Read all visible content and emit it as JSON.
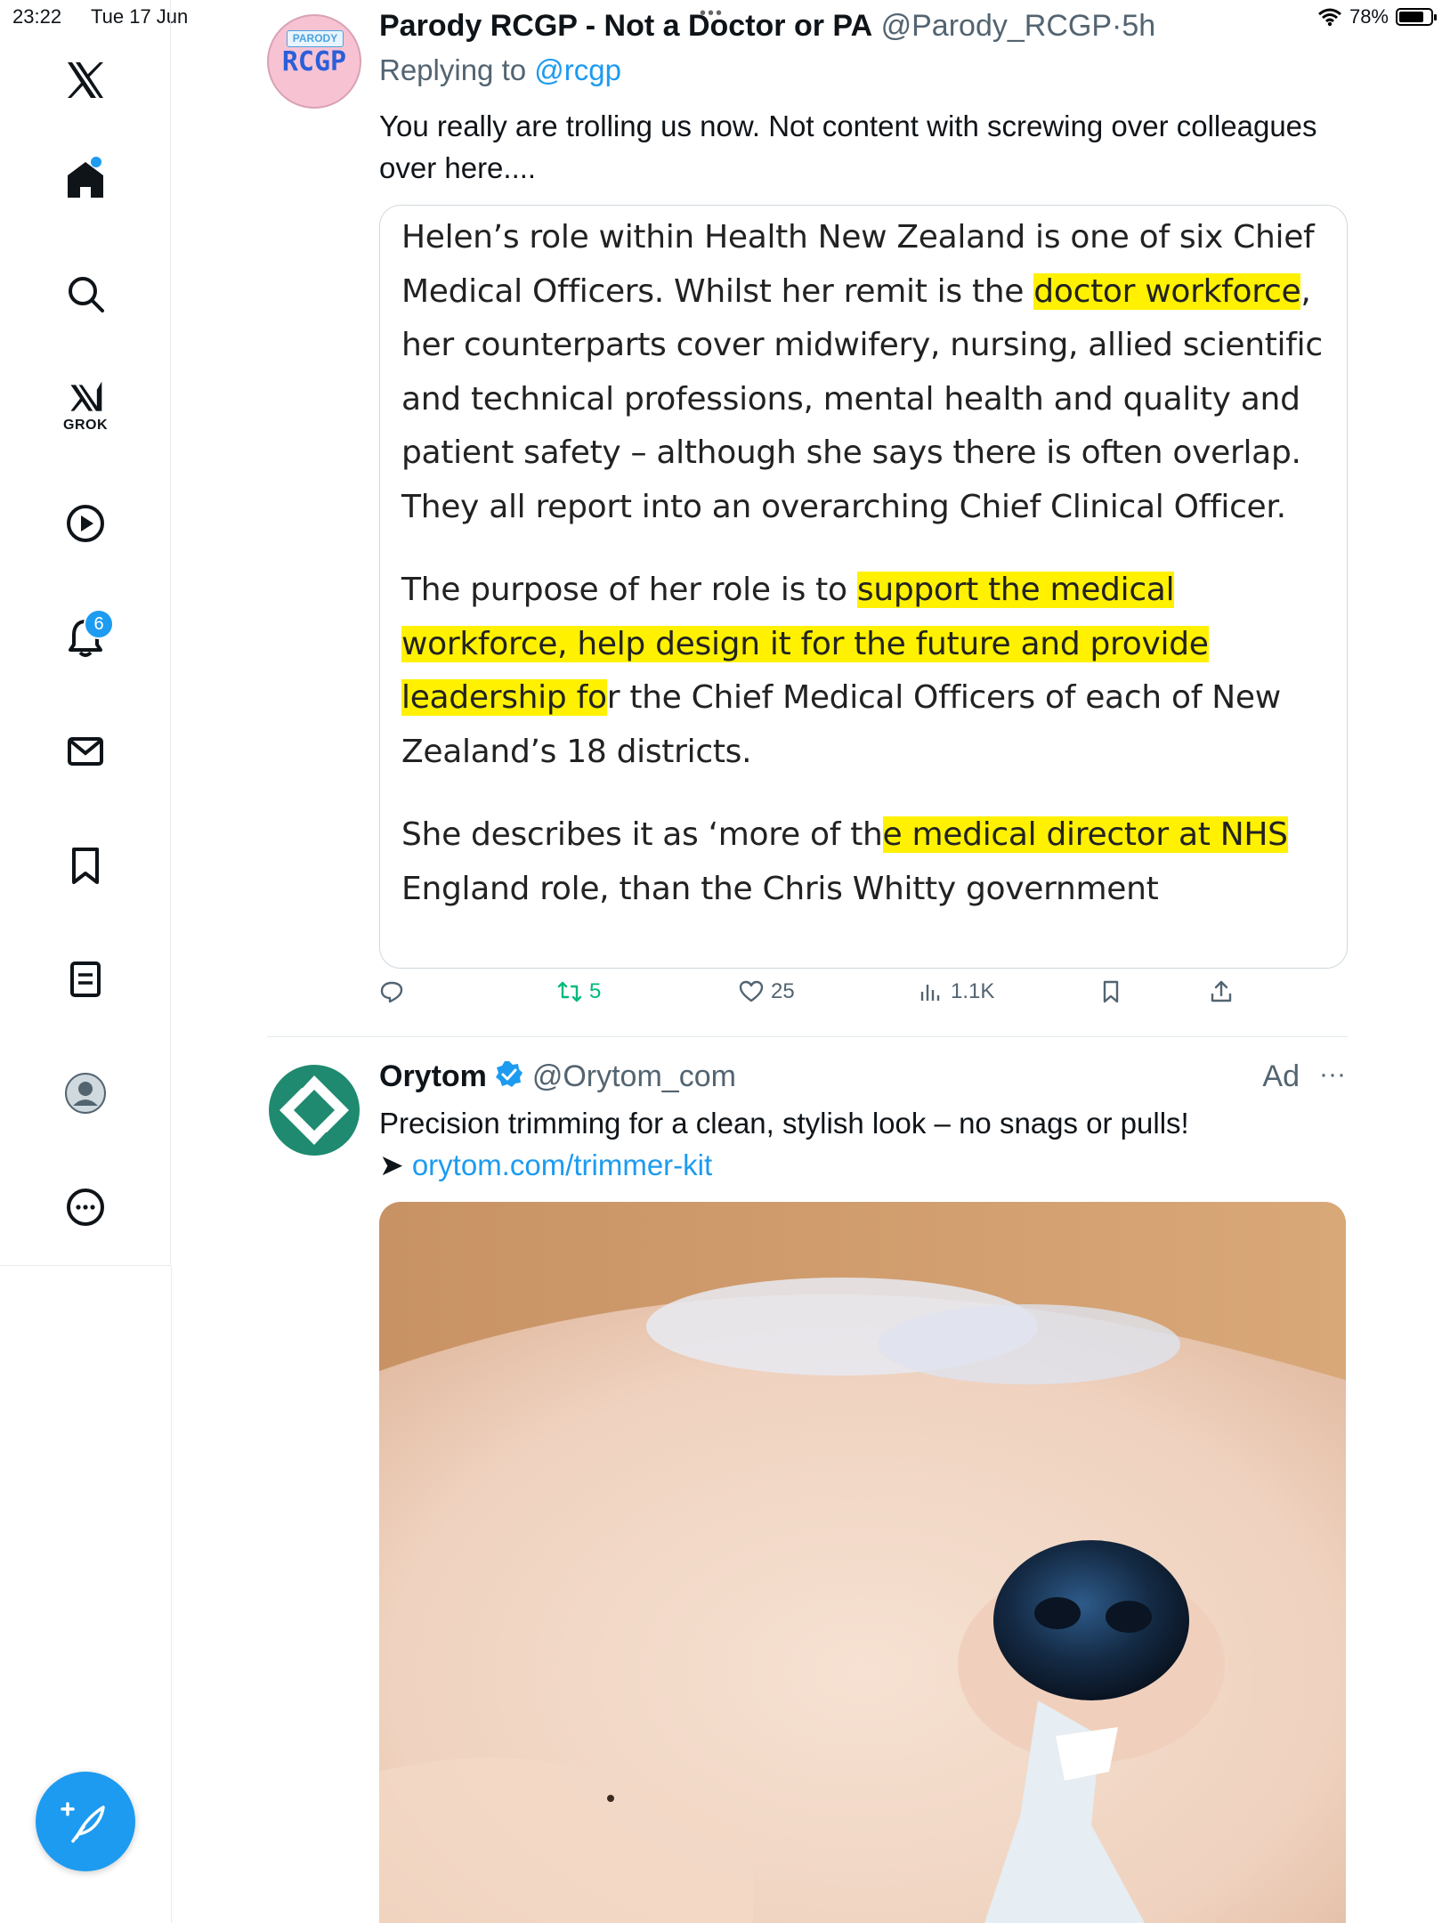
{
  "status_bar": {
    "time": "23:22",
    "date": "Tue 17 Jun",
    "dots": "•••",
    "battery": "78%"
  },
  "sidebar": {
    "items": [
      {
        "name": "x-logo",
        "glyph": "𝕏"
      },
      {
        "name": "home",
        "icon": "home-icon"
      },
      {
        "name": "explore",
        "icon": "search-icon"
      },
      {
        "name": "grok",
        "icon": "grok-icon",
        "label": "GROK"
      },
      {
        "name": "video",
        "icon": "play-icon"
      },
      {
        "name": "notifications",
        "icon": "bell-icon",
        "badge": "6"
      },
      {
        "name": "messages",
        "icon": "mail-icon"
      },
      {
        "name": "bookmarks",
        "icon": "bookmark-icon"
      },
      {
        "name": "lists",
        "icon": "list-icon"
      },
      {
        "name": "profile",
        "icon": "avatar-icon"
      },
      {
        "name": "more",
        "icon": "more-icon"
      }
    ],
    "compose_icon": "compose-feather-icon"
  },
  "tweet": {
    "avatar": {
      "badge": "PARODY",
      "text": "RCGP"
    },
    "display_name": "Parody RCGP - Not a Doctor or PA",
    "handle": "@Parody_RCGP",
    "separator": "·",
    "time": "5h",
    "replying_prefix": "Replying to",
    "replying_to": "@rcgp",
    "text": "You really are trolling us now. Not content with screwing over colleagues over here....",
    "quote": {
      "p1_a": "Helen’s role within Health New Zealand is one of six Chief Medical Officers. Whilst her remit is the ",
      "p1_hl": "doctor workforce",
      "p1_b": ", her counterparts cover midwifery, nursing, allied scientific and technical professions, mental health and quality and patient safety – although she says there is often overlap. They all report into an overarching Chief Clinical Officer.",
      "p2_a": "The purpose of her role is to ",
      "p2_hl": "support the medical workforce, help design it for the future and provide leadership fo",
      "p2_b": "r the Chief Medical Officers of each of New Zealand’s 18 districts.",
      "p3_a": "She describes it as ‘more of th",
      "p3_hl": "e medical director at NHS",
      "p3_b": " England role, than the Chris Whitty government"
    },
    "actions": {
      "reply_count": "",
      "retweet_count": "5",
      "like_count": "25",
      "view_count": "1.1K"
    }
  },
  "ad": {
    "display_name": "Orytom",
    "handle": "@Orytom_com",
    "ad_label": "Ad",
    "more": "···",
    "text": "Precision trimming for a clean, stylish look – no snags or pulls!",
    "arrow": "➤ ",
    "link": "orytom.com/trimmer-kit",
    "colors": {
      "logo": "#1f8a6f"
    }
  }
}
